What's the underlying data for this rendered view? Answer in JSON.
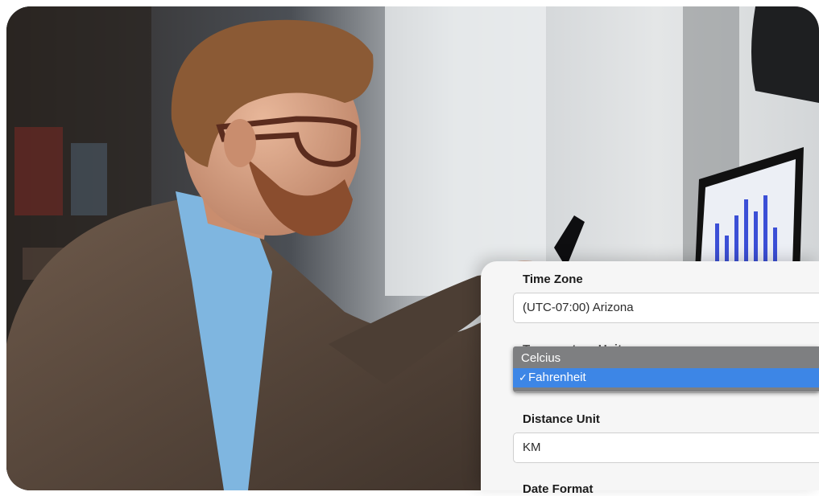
{
  "settings": {
    "time_zone": {
      "label": "Time Zone",
      "value": "(UTC-07:00) Arizona"
    },
    "temperature_unit": {
      "label": "Temperature Unit",
      "options": [
        "Celcius",
        "Fahrenheit"
      ],
      "selected": "Fahrenheit",
      "check_glyph": "✓"
    },
    "distance_unit": {
      "label": "Distance Unit",
      "value": "KM"
    },
    "date_format": {
      "label": "Date Format"
    }
  },
  "colors": {
    "selection_blue": "#3d86e6",
    "dropdown_gray": "#7e7f81",
    "panel_bg": "#f6f6f6"
  },
  "icons": [
    "checkmark-icon"
  ]
}
